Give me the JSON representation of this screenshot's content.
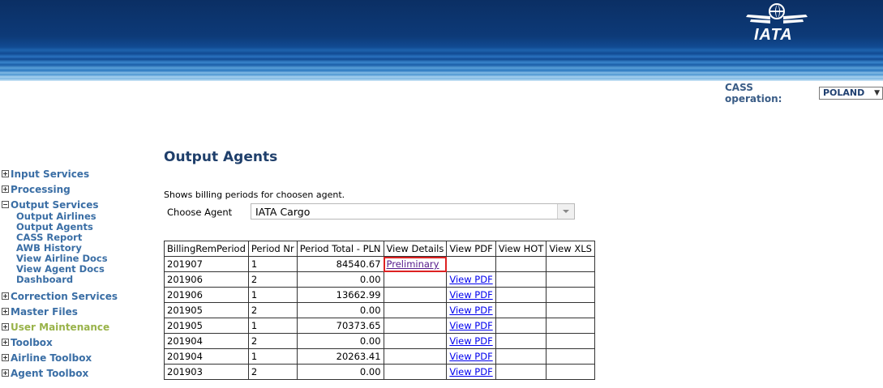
{
  "header": {
    "logo_text": "IATA",
    "colors": {
      "banner_dark": "#0b2f64",
      "banner_light": "#d2e8f7"
    }
  },
  "cass": {
    "label": "CASS operation:",
    "selected": "POLAND"
  },
  "sidebar": {
    "items": [
      {
        "label": "Input Services",
        "expander": "plus"
      },
      {
        "label": "Processing",
        "expander": "plus"
      },
      {
        "label": "Output Services",
        "expander": "minus",
        "children": [
          "Output Airlines",
          "Output Agents",
          "CASS Report",
          "AWB History",
          "View Airline Docs",
          "View Agent Docs",
          "Dashboard"
        ]
      },
      {
        "label": "Correction Services",
        "expander": "plus"
      },
      {
        "label": "Master Files",
        "expander": "plus"
      },
      {
        "label": "User Maintenance",
        "expander": "plus",
        "active": true
      },
      {
        "label": "Toolbox",
        "expander": "plus"
      },
      {
        "label": "Airline Toolbox",
        "expander": "plus"
      },
      {
        "label": "Agent Toolbox",
        "expander": "plus"
      }
    ]
  },
  "main": {
    "title": "Output Agents",
    "description": "Shows billing periods for choosen agent.",
    "agent_label": "Choose Agent",
    "agent_value": "IATA Cargo"
  },
  "table": {
    "headers": [
      "BillingRemPeriod",
      "Period Nr",
      "Period Total - PLN",
      "View Details",
      "View PDF",
      "View HOT",
      "View XLS"
    ],
    "rows": [
      [
        "201907",
        "1",
        "84540.67",
        "Preliminary",
        "",
        "",
        ""
      ],
      [
        "201906",
        "2",
        "0.00",
        "",
        "View PDF",
        "",
        ""
      ],
      [
        "201906",
        "1",
        "13662.99",
        "",
        "View PDF",
        "",
        ""
      ],
      [
        "201905",
        "2",
        "0.00",
        "",
        "View PDF",
        "",
        ""
      ],
      [
        "201905",
        "1",
        "70373.65",
        "",
        "View PDF",
        "",
        ""
      ],
      [
        "201904",
        "2",
        "0.00",
        "",
        "View PDF",
        "",
        ""
      ],
      [
        "201904",
        "1",
        "20263.41",
        "",
        "View PDF",
        "",
        ""
      ],
      [
        "201903",
        "2",
        "0.00",
        "",
        "View PDF",
        "",
        ""
      ]
    ]
  }
}
